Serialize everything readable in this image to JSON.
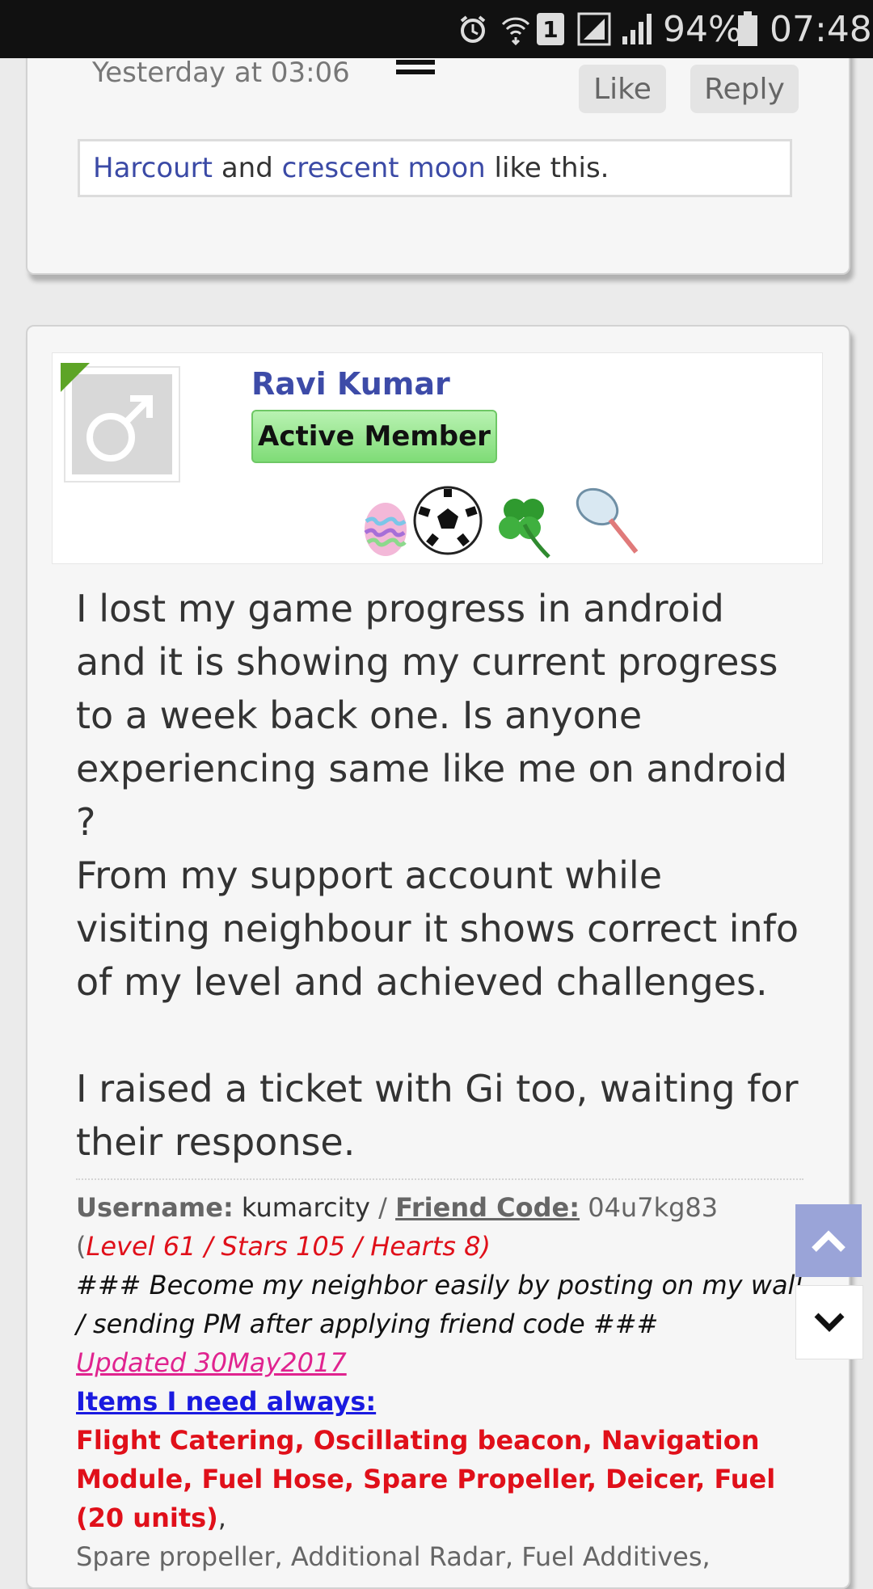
{
  "status_bar": {
    "battery_percent": "94%",
    "time": "07:48",
    "sim_label": "1"
  },
  "prev_post": {
    "timestamp": "Yesterday at 03:06",
    "like_label": "Like",
    "reply_label": "Reply",
    "likers": [
      "Harcourt",
      "crescent moon"
    ],
    "and_word": "and",
    "like_suffix": "like this."
  },
  "post": {
    "author": "Ravi Kumar",
    "role_badge": "Active Member",
    "trophy_icons": [
      "easter-egg-icon",
      "soccer-ball-icon",
      "four-leaf-clover-icon",
      "butterfly-net-icon"
    ],
    "paragraphs": [
      "I lost my game progress in android and it is showing my current progress to a week back one. Is anyone experiencing same like me on android ?",
      "From my support account while visiting neighbour it shows correct info of my level and achieved challenges.",
      "I raised a ticket with Gi too, waiting for their response."
    ]
  },
  "signature": {
    "username_label": "Username:",
    "username": "kumarcity",
    "sep": "/",
    "friend_code_label": "Friend Code:",
    "friend_code": "04u7kg83",
    "open_paren": "(",
    "level_info": "Level 61 / Stars 105 / Hearts 8)",
    "neighbor_note": "### Become my neighbor easily by posting on my wall / sending PM after applying friend code ###",
    "updated": "Updated 30May2017",
    "items_heading": "Items I need always:",
    "items_priority": "Flight Catering, Oscillating beacon, Navigation Module, Fuel Hose, Spare Propeller, Deicer, Fuel (20 units)",
    "comma": ",",
    "items_other": "Spare propeller, Additional Radar, Fuel Additives,"
  }
}
